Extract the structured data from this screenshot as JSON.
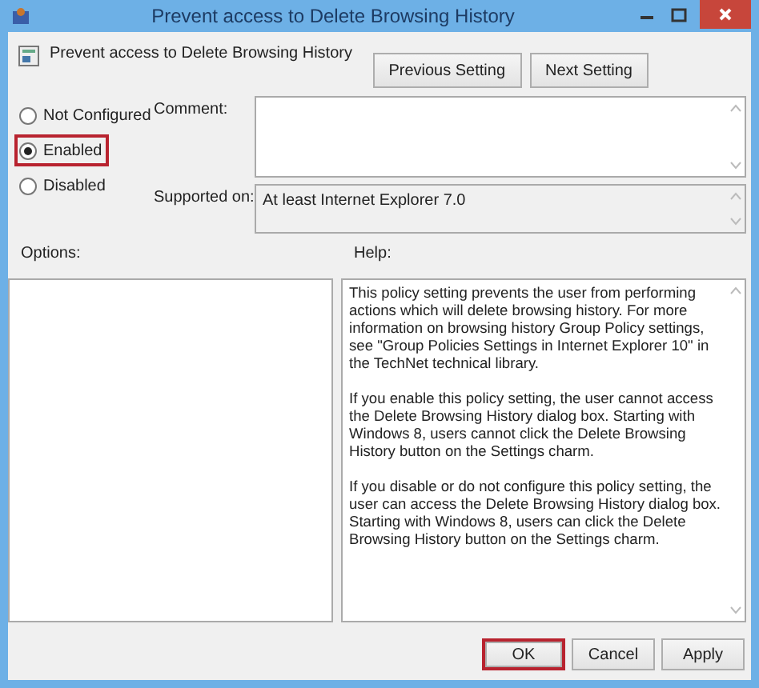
{
  "window": {
    "title": "Prevent access to Delete Browsing History"
  },
  "header": {
    "setting_name": "Prevent access to Delete Browsing History",
    "buttons": [
      "Previous Setting",
      "Next Setting"
    ]
  },
  "state_options": [
    {
      "label": "Not Configured",
      "selected": false,
      "highlighted": false
    },
    {
      "label": "Enabled",
      "selected": true,
      "highlighted": true
    },
    {
      "label": "Disabled",
      "selected": false,
      "highlighted": false
    }
  ],
  "comment": {
    "label": "Comment:"
  },
  "supported_on": {
    "label": "Supported on:",
    "value": "At least Internet Explorer 7.0"
  },
  "options": {
    "label": "Options:"
  },
  "help": {
    "label": "Help:",
    "paragraphs": [
      "This policy setting prevents the user from performing actions which will delete browsing history. For more information on browsing history Group Policy settings, see \"Group Policies Settings in Internet Explorer 10\" in the TechNet technical library.",
      "If you enable this policy setting, the user cannot access the Delete Browsing History dialog box. Starting with Windows 8, users cannot click the Delete Browsing History button on the Settings charm.",
      "If you disable or do not configure this policy setting, the user can access the Delete Browsing History dialog box. Starting with Windows 8, users can click the Delete Browsing History button on the Settings charm."
    ]
  },
  "footer_buttons": [
    {
      "label": "OK",
      "highlighted": true
    },
    {
      "label": "Cancel",
      "highlighted": false
    },
    {
      "label": "Apply",
      "highlighted": false
    }
  ]
}
